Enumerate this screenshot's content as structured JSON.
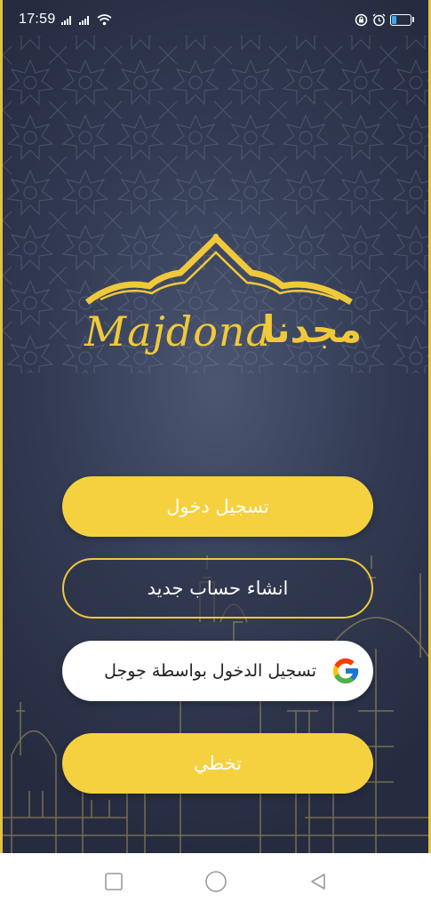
{
  "status": {
    "time": "17:59",
    "battery_level": 0.25,
    "battery_color": "#3aa8f0",
    "icons": [
      "signal-icon",
      "signal-icon",
      "wifi-icon",
      "rotation-lock-icon",
      "alarm-icon",
      "battery-icon"
    ]
  },
  "brand": {
    "latin": "Majdona",
    "arabic": "مجدنا",
    "color": "#f0c93a"
  },
  "buttons": {
    "login": "تسجيل دخول",
    "register": "انشاء حساب جديد",
    "google": "تسجيل الدخول بواسطة جوجل",
    "skip": "تخطي"
  },
  "theme": {
    "background": "#323a52",
    "accent": "#f5d140"
  },
  "navbar": {
    "icons": [
      "recent-apps-icon",
      "home-icon",
      "back-icon"
    ]
  }
}
